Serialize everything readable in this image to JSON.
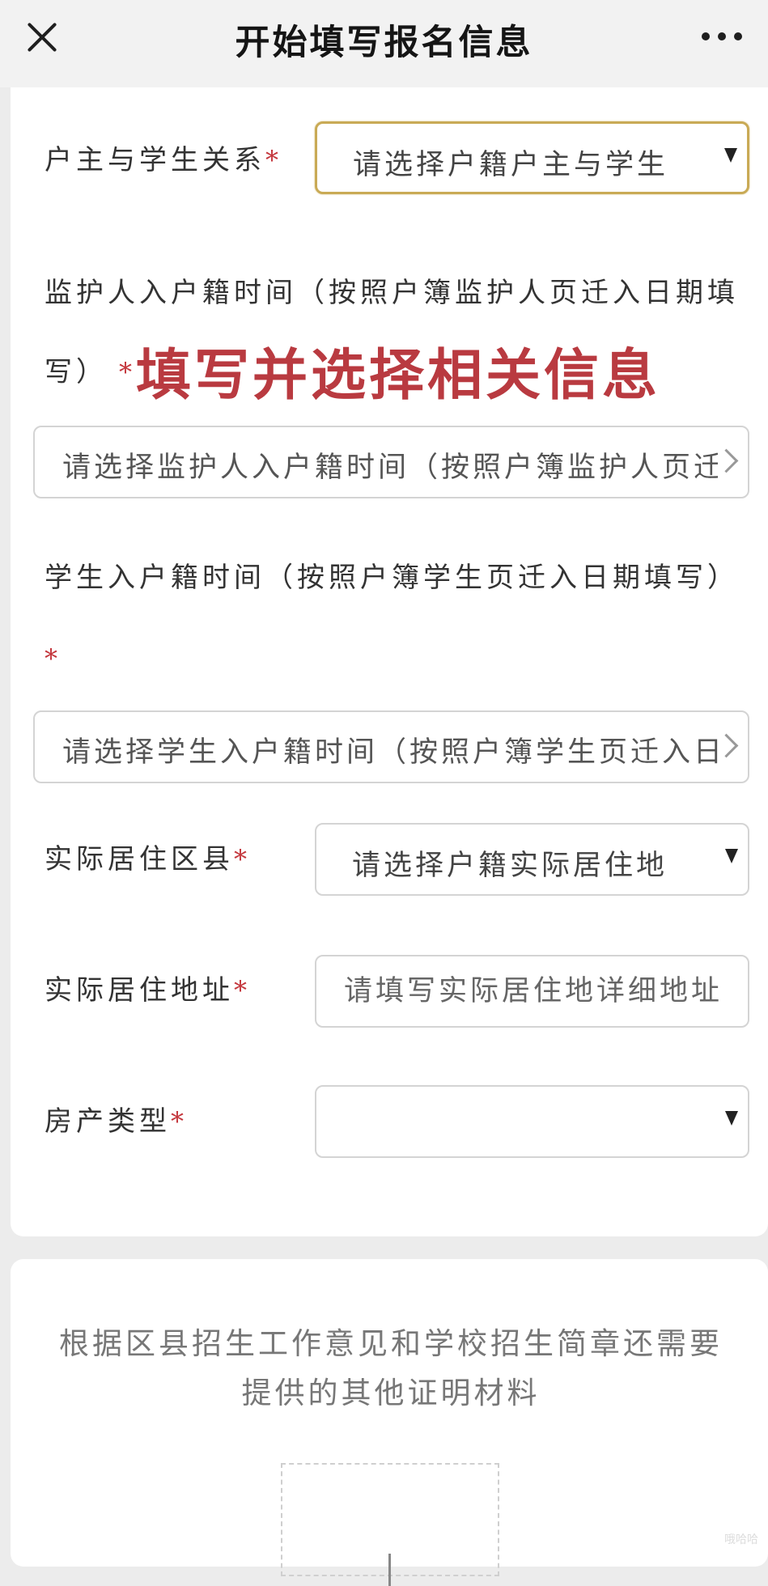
{
  "header": {
    "title": "开始填写报名信息"
  },
  "form": {
    "relationship": {
      "label": "户主与学生关系",
      "required_mark": "*",
      "value": "请选择户籍户主与学生"
    },
    "guardian_time": {
      "label_line1": "监护人入户籍时间（按照户簿监护人页迁入日期填",
      "label_line2": "写）",
      "required_mark": "*",
      "placeholder": "请选择监护人入户籍时间（按照户簿监护人页迁入日期填写）"
    },
    "annotation": "填写并选择相关信息",
    "student_time": {
      "label": "学生入户籍时间（按照户簿学生页迁入日期填写）",
      "required_mark": "*",
      "placeholder": "请选择学生入户籍时间（按照户簿学生页迁入日期填写）"
    },
    "residence_district": {
      "label": "实际居住区县",
      "required_mark": "*",
      "value": "请选择户籍实际居住地"
    },
    "residence_address": {
      "label": "实际居住地址",
      "required_mark": "*",
      "placeholder": "请填写实际居住地详细地址"
    },
    "property_type": {
      "label": "房产类型",
      "required_mark": "*",
      "value": ""
    }
  },
  "materials": {
    "text": "根据区县招生工作意见和学校招生简章还需要提供的其他证明材料"
  },
  "watermark": "哦哈哈"
}
